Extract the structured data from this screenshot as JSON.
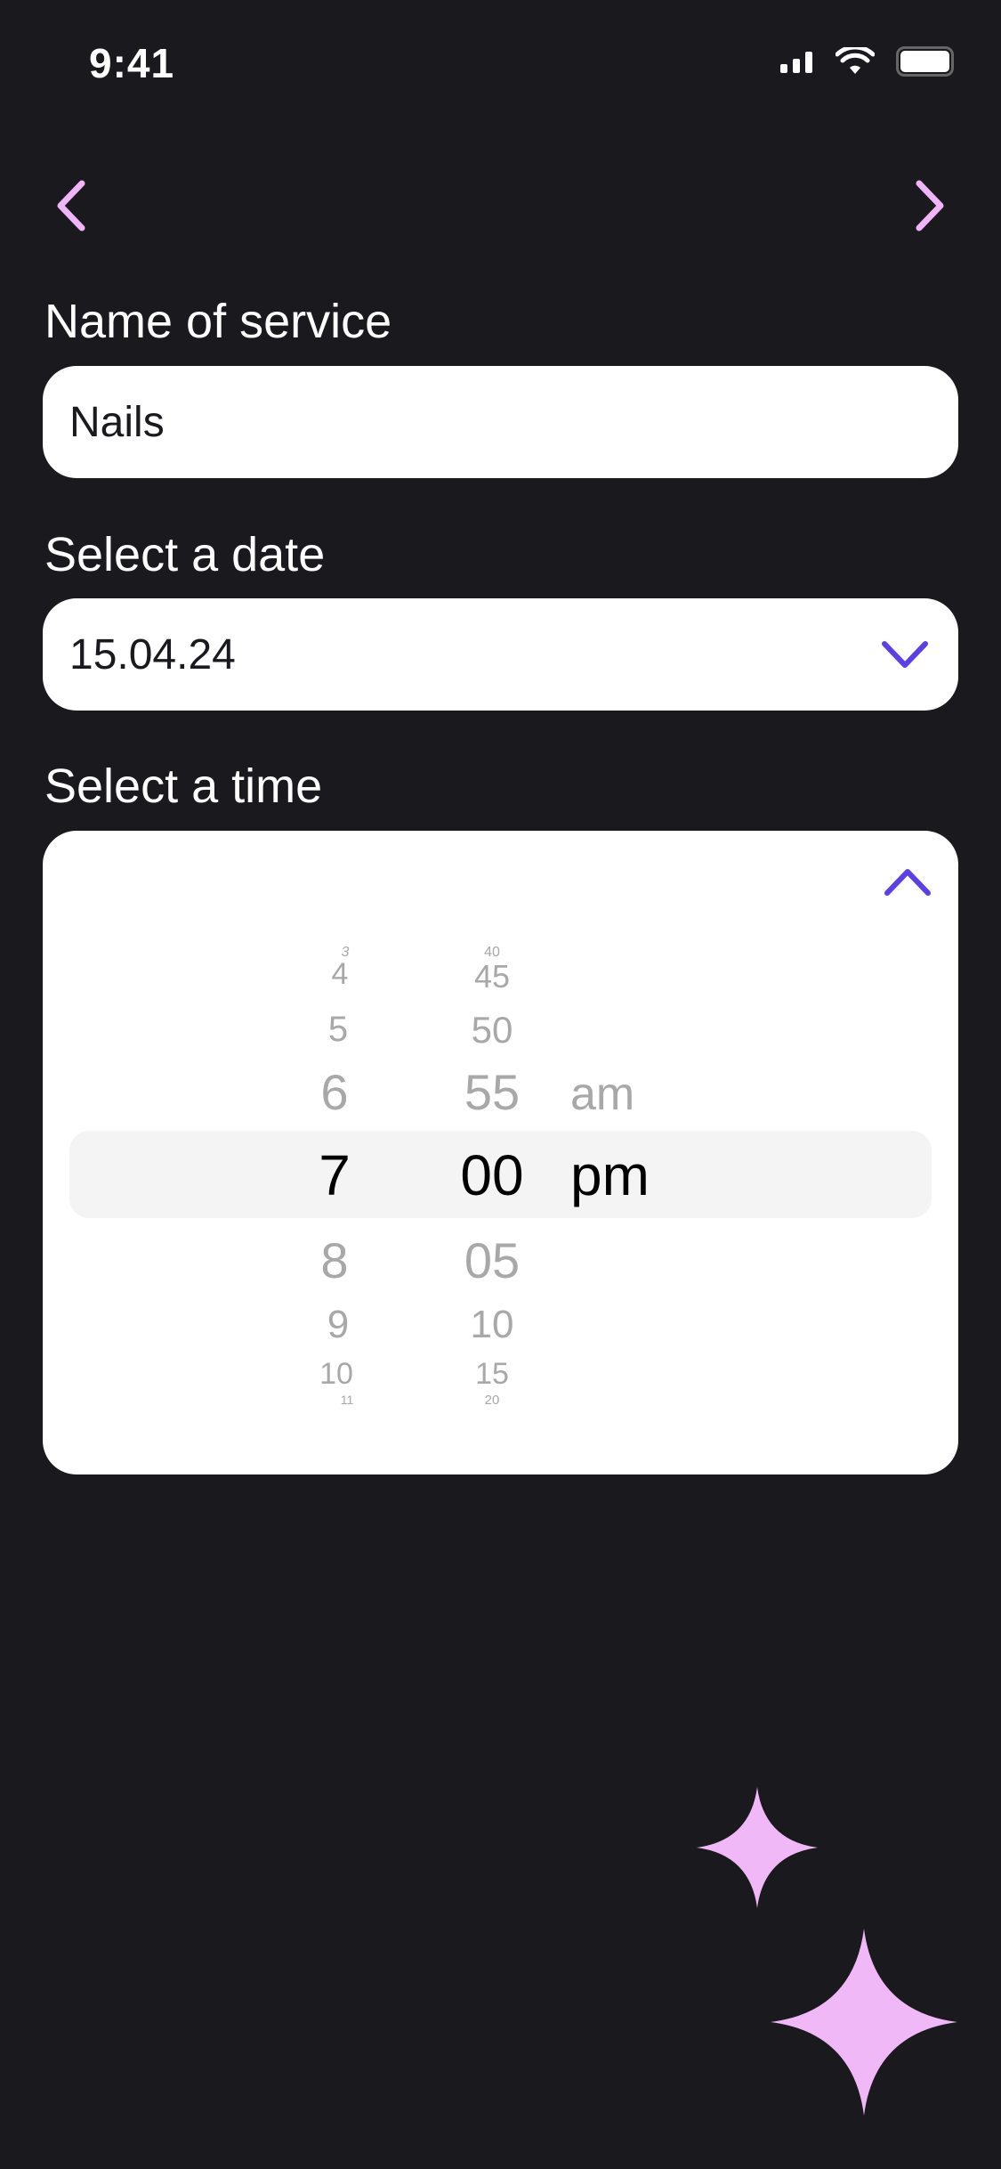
{
  "status_bar": {
    "time": "9:41"
  },
  "nav": {
    "back_icon": "chevron-left-icon",
    "forward_icon": "chevron-right-icon",
    "accent": "#F0B4F8"
  },
  "service": {
    "label": "Name of service",
    "value": "Nails"
  },
  "date": {
    "label": "Select a date",
    "value": "15.04.24",
    "icon": "chevron-down-icon"
  },
  "time": {
    "label": "Select a time",
    "collapse_icon": "chevron-up-icon",
    "hours": [
      "3",
      "4",
      "5",
      "6",
      "7",
      "8",
      "9",
      "10",
      "11"
    ],
    "minutes": [
      "40",
      "45",
      "50",
      "55",
      "00",
      "05",
      "10",
      "15",
      "20"
    ],
    "periods": [
      "am",
      "pm"
    ],
    "selected": {
      "hour": "7",
      "minute": "00",
      "period": "pm"
    }
  },
  "colors": {
    "background": "#1A191E",
    "accent_purple": "#5B3FE8",
    "sparkle_pink": "#F0B8F7"
  }
}
